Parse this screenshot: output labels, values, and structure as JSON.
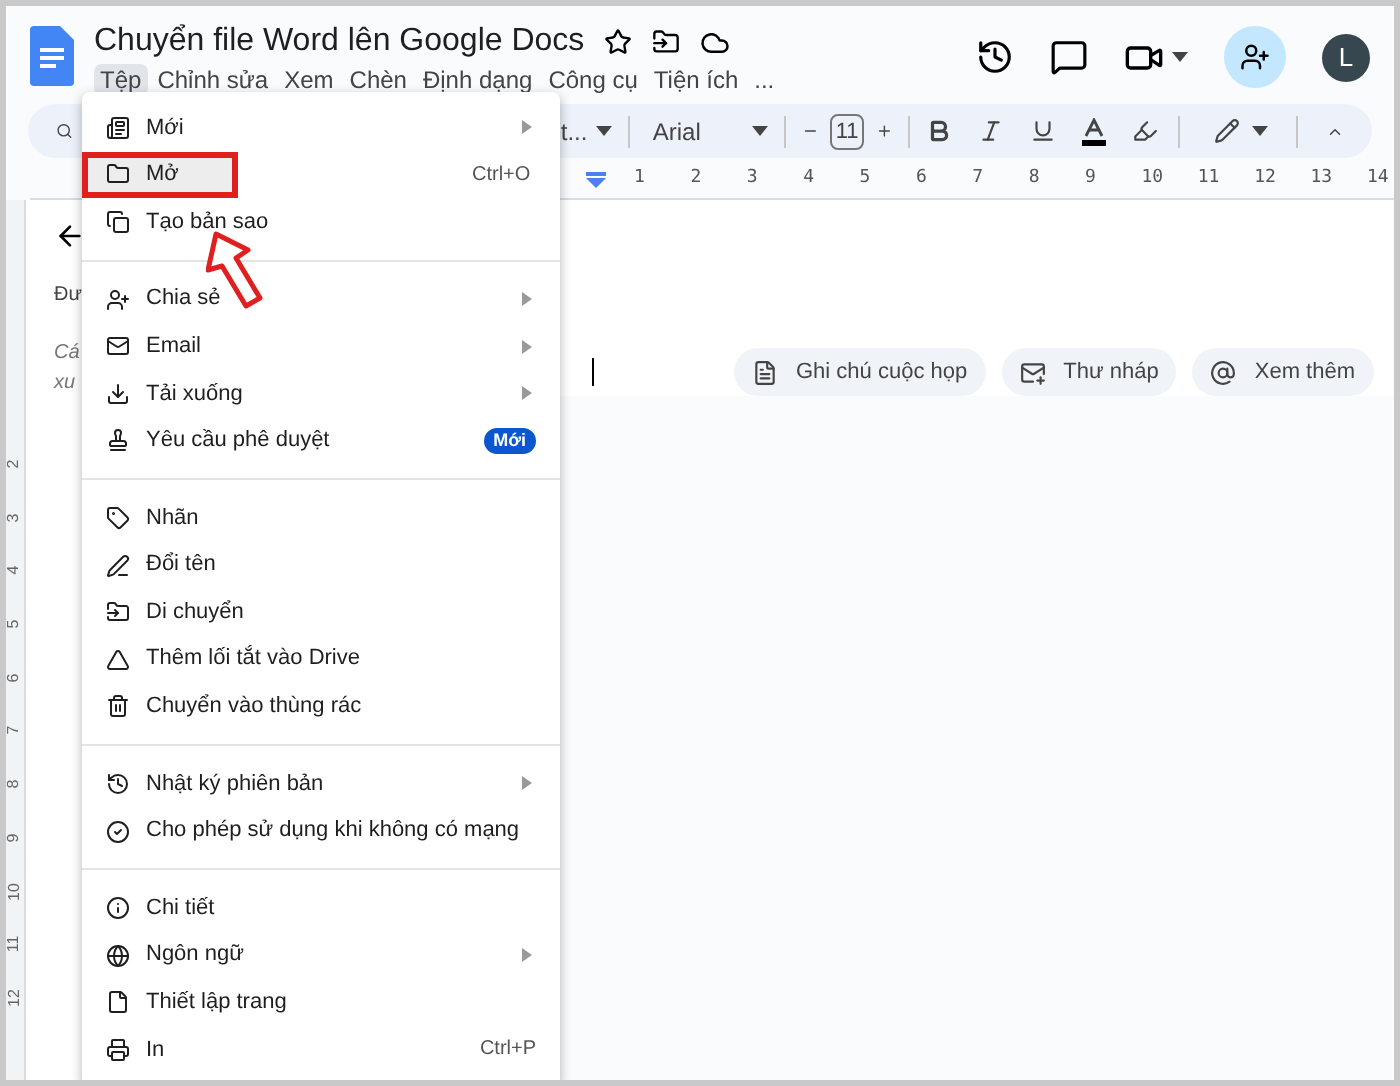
{
  "document": {
    "title": "Chuyển file Word lên Google Docs"
  },
  "menubar": [
    {
      "label": "Tệp",
      "selected": true
    },
    {
      "label": "Chỉnh sửa",
      "selected": false
    },
    {
      "label": "Xem",
      "selected": false
    },
    {
      "label": "Chèn",
      "selected": false
    },
    {
      "label": "Định dạng",
      "selected": false
    },
    {
      "label": "Công cụ",
      "selected": false
    },
    {
      "label": "Tiện ích",
      "selected": false
    },
    {
      "label": "...",
      "selected": false
    }
  ],
  "avatar": {
    "initial": "L"
  },
  "toolbar": {
    "style_fragment": "t...",
    "font": "Arial",
    "font_size": "11"
  },
  "ruler": {
    "numbers": [
      "1",
      "2",
      "3",
      "4",
      "5",
      "6",
      "7",
      "8",
      "9",
      "10",
      "11",
      "12",
      "13",
      "14"
    ]
  },
  "vertical_ruler": {
    "numbers": [
      "2",
      "3",
      "4",
      "5",
      "6",
      "7",
      "8",
      "9",
      "10",
      "11",
      "12"
    ]
  },
  "outline": {
    "fragments": [
      "Đư",
      "Cá",
      "xu"
    ]
  },
  "chips": [
    {
      "label": "Ghi chú cuộc họp"
    },
    {
      "label": "Thư nháp"
    },
    {
      "label": "Xem thêm"
    }
  ],
  "file_menu": [
    {
      "kind": "item",
      "label": "Mới",
      "submenu": true,
      "highlighted": false,
      "annotated": false
    },
    {
      "kind": "item",
      "label": "Mở",
      "shortcut": "Ctrl+O",
      "submenu": false,
      "highlighted": true,
      "annotated": true
    },
    {
      "kind": "item",
      "label": "Tạo bản sao",
      "submenu": false,
      "highlighted": false,
      "annotated": false
    },
    {
      "kind": "divider"
    },
    {
      "kind": "item",
      "label": "Chia sẻ",
      "submenu": true,
      "highlighted": false,
      "annotated": false
    },
    {
      "kind": "item",
      "label": "Email",
      "submenu": true,
      "highlighted": false,
      "annotated": false
    },
    {
      "kind": "item",
      "label": "Tải xuống",
      "submenu": true,
      "highlighted": false,
      "annotated": false
    },
    {
      "kind": "item",
      "label": "Yêu cầu phê duyệt",
      "badge": "Mới",
      "submenu": false,
      "highlighted": false,
      "annotated": false
    },
    {
      "kind": "divider"
    },
    {
      "kind": "item",
      "label": "Nhãn",
      "submenu": false,
      "highlighted": false,
      "annotated": false
    },
    {
      "kind": "item",
      "label": "Đổi tên",
      "submenu": false,
      "highlighted": false,
      "annotated": false
    },
    {
      "kind": "item",
      "label": "Di chuyển",
      "submenu": false,
      "highlighted": false,
      "annotated": false
    },
    {
      "kind": "item",
      "label": "Thêm lối tắt vào Drive",
      "submenu": false,
      "highlighted": false,
      "annotated": false
    },
    {
      "kind": "item",
      "label": "Chuyển vào thùng rác",
      "submenu": false,
      "highlighted": false,
      "annotated": false
    },
    {
      "kind": "divider"
    },
    {
      "kind": "item",
      "label": "Nhật ký phiên bản",
      "submenu": true,
      "highlighted": false,
      "annotated": false
    },
    {
      "kind": "item",
      "label": "Cho phép sử dụng khi không có mạng",
      "submenu": false,
      "highlighted": false,
      "annotated": false
    },
    {
      "kind": "divider"
    },
    {
      "kind": "item",
      "label": "Chi tiết",
      "submenu": false,
      "highlighted": false,
      "annotated": false
    },
    {
      "kind": "item",
      "label": "Ngôn ngữ",
      "submenu": true,
      "highlighted": false,
      "annotated": false
    },
    {
      "kind": "item",
      "label": "Thiết lập trang",
      "submenu": false,
      "highlighted": false,
      "annotated": false
    },
    {
      "kind": "item",
      "label": "In",
      "shortcut": "Ctrl+P",
      "submenu": false,
      "highlighted": false,
      "annotated": false
    }
  ]
}
